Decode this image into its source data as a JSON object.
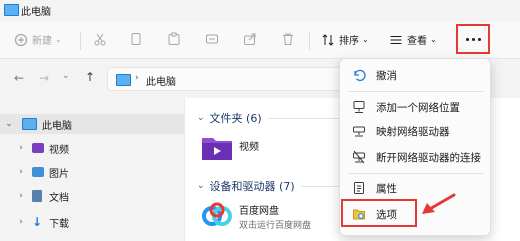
{
  "window": {
    "title": "此电脑"
  },
  "toolbar": {
    "new_label": "新建",
    "sort_label": "排序",
    "view_label": "查看"
  },
  "address": {
    "path": "此电脑"
  },
  "nav": {
    "items": [
      {
        "label": "此电脑",
        "icon": "computer-icon"
      },
      {
        "label": "视频",
        "icon": "video-folder-icon"
      },
      {
        "label": "图片",
        "icon": "pictures-folder-icon"
      },
      {
        "label": "文档",
        "icon": "documents-folder-icon"
      },
      {
        "label": "下载",
        "icon": "downloads-folder-icon"
      }
    ]
  },
  "content": {
    "folders_header": "文件夹 (6)",
    "folder_items": [
      {
        "label": "视频"
      }
    ],
    "devices_header": "设备和驱动器 (7)",
    "device_items": [
      {
        "name": "百度网盘",
        "sub": "双击运行百度网盘"
      }
    ]
  },
  "menu": {
    "items": [
      {
        "label": "撤消",
        "icon": "undo-icon"
      },
      {
        "label": "添加一个网络位置",
        "icon": "network-location-icon"
      },
      {
        "label": "映射网络驱动器",
        "icon": "map-drive-icon"
      },
      {
        "label": "断开网络驱动器的连接",
        "icon": "disconnect-drive-icon"
      },
      {
        "label": "属性",
        "icon": "properties-icon"
      },
      {
        "label": "选项",
        "icon": "options-icon"
      }
    ]
  },
  "colors": {
    "highlight": "#e53935",
    "accent": "#1e7dd6",
    "video_folder": "#7a3fbf"
  }
}
